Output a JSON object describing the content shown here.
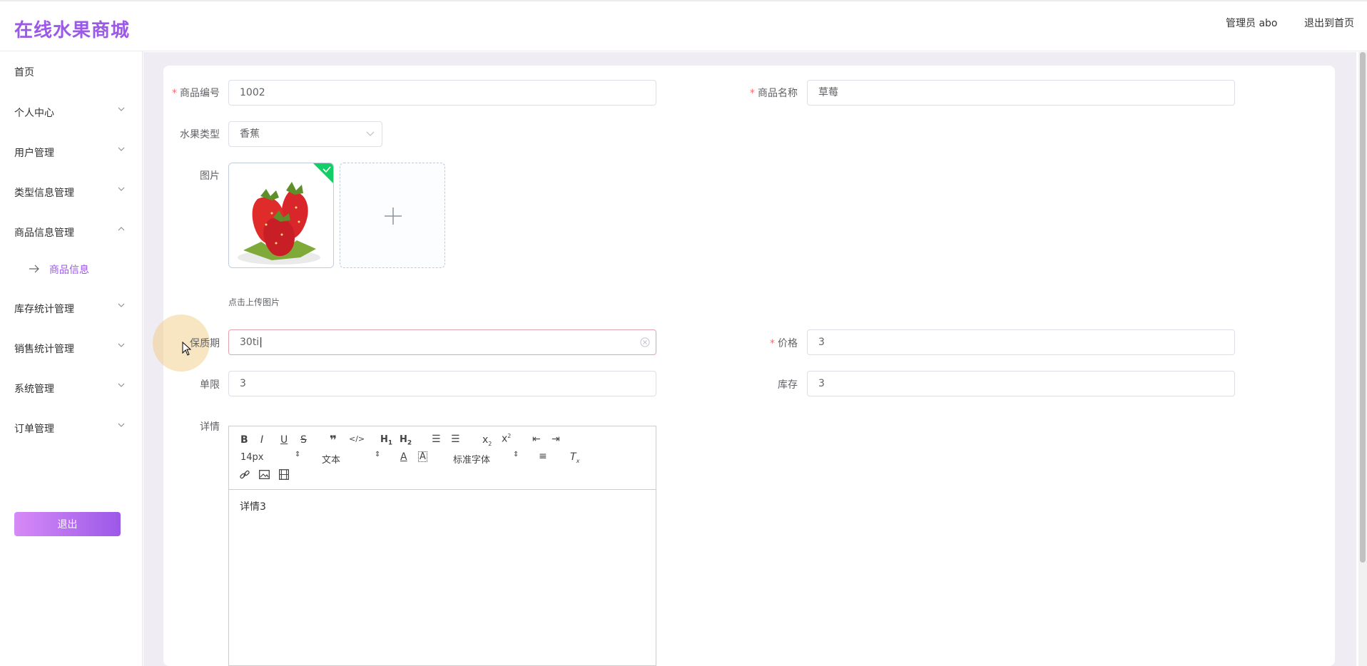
{
  "header": {
    "brand": "在线水果商城",
    "user": "管理员 abo",
    "back_home": "退出到首页"
  },
  "sidebar": {
    "items": [
      {
        "label": "首页",
        "expandable": false
      },
      {
        "label": "个人中心",
        "expandable": true
      },
      {
        "label": "用户管理",
        "expandable": true
      },
      {
        "label": "类型信息管理",
        "expandable": true
      },
      {
        "label": "商品信息管理",
        "expandable": true,
        "expanded": true
      },
      {
        "label": "库存统计管理",
        "expandable": true
      },
      {
        "label": "销售统计管理",
        "expandable": true
      },
      {
        "label": "系统管理",
        "expandable": true
      },
      {
        "label": "订单管理",
        "expandable": true
      }
    ],
    "active_sub": "商品信息",
    "logout": "退出"
  },
  "form": {
    "product_no": {
      "label": "商品编号",
      "value": "1002",
      "required": true
    },
    "product_name": {
      "label": "商品名称",
      "value": "草莓",
      "required": true
    },
    "fruit_type": {
      "label": "水果类型",
      "value": "香蕉"
    },
    "image": {
      "label": "图片",
      "tip": "点击上传图片",
      "uploaded": true
    },
    "shelf_life": {
      "label": "保质期",
      "value": "30ti"
    },
    "price": {
      "label": "价格",
      "value": "3",
      "required": true
    },
    "limit": {
      "label": "单限",
      "value": "3"
    },
    "stock": {
      "label": "库存",
      "value": "3"
    },
    "detail": {
      "label": "详情",
      "content": "详情3",
      "font_size": "14px",
      "text_type": "文本",
      "font_family": "标准字体"
    }
  },
  "colors": {
    "brand": "#9b59e8",
    "required": "#f56c6c",
    "uploaded_badge": "#13ce66"
  }
}
